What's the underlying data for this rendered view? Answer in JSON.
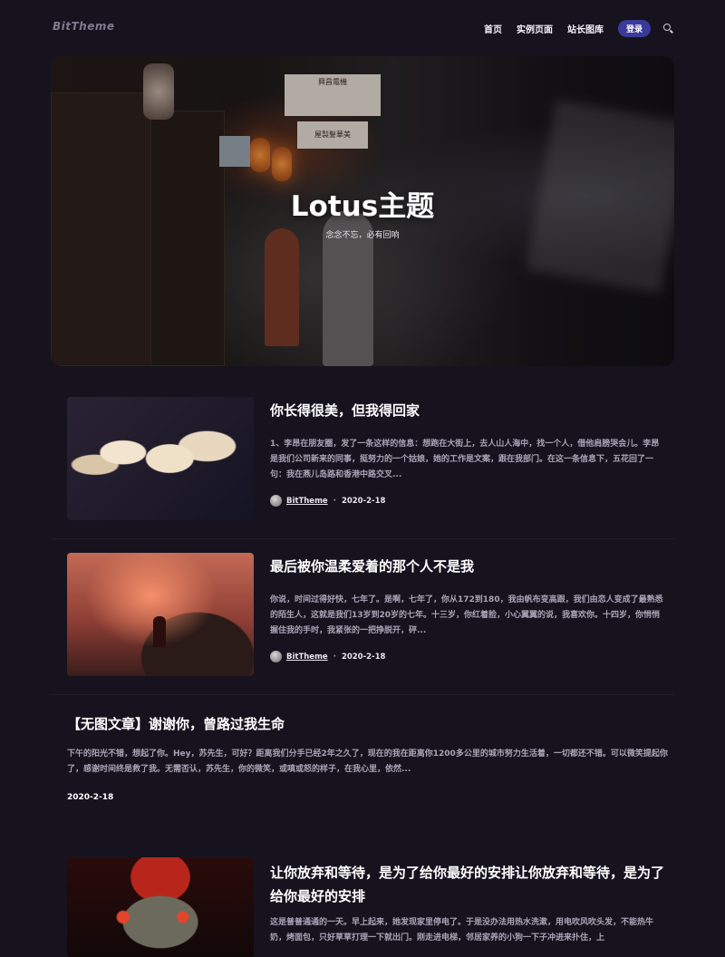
{
  "header": {
    "logo": "BitTheme",
    "nav": [
      "首页",
      "实例页面",
      "站长图库"
    ],
    "login": "登录"
  },
  "hero": {
    "title": "Lotus主题",
    "subtitle": "念念不忘，必有回响",
    "signs": [
      "興昌電機",
      "屋製髮華美"
    ]
  },
  "posts": [
    {
      "title": "你长得很美，但我得回家",
      "excerpt": "1、李昂在朋友圈，发了一条这样的信息：想跑在大街上，去人山人海中，找一个人，借他肩膀哭会儿。李昂是我们公司新来的同事，挺努力的一个姑娘，她的工作是文案，跟在我部门。在这一条信息下，五花回了一句：我在燕儿岛路和香港中路交叉...",
      "author": "BitTheme",
      "date": "2020-2-18"
    },
    {
      "title": "最后被你温柔爱着的那个人不是我",
      "excerpt": "你说，时间过得好快，七年了。是啊，七年了，你从172到180，我由帆布变高跟，我们由恋人变成了最熟悉的陌生人，这就是我们13岁到20岁的七年。十三岁，你红着脸，小心翼翼的说，我喜欢你。十四岁，你悄悄握住我的手时，我紧张的一把挣脱开，砰...",
      "author": "BitTheme",
      "date": "2020-2-18"
    },
    {
      "title": "【无图文章】谢谢你，曾路过我生命",
      "excerpt": "下午的阳光不错，想起了你。Hey，苏先生，可好？距离我们分手已经2年之久了，现在的我在距离你1200多公里的城市努力生活着，一切都还不错。可以微笑提起你了，感谢时间终是救了我。无需否认，苏先生，你的微笑，或嗔或怒的样子，在我心里，依然...",
      "date": "2020-2-18"
    },
    {
      "title": "让你放弃和等待，是为了给你最好的安排让你放弃和等待，是为了给你最好的安排",
      "excerpt": "这是普普通通的一天。早上起来，她发现家里停电了。于是没办法用热水洗漱，用电吹风吹头发，不能热牛奶，烤面包，只好草草打理一下就出门。刚走进电梯，邻居家养的小狗一下子冲进来扑住，上"
    }
  ],
  "colors": {
    "background": "#16131f",
    "accent": "#3a3a9a",
    "title": "#ffffff",
    "muted": "#a8a4b5"
  },
  "icons": [
    "search-icon",
    "avatar"
  ]
}
